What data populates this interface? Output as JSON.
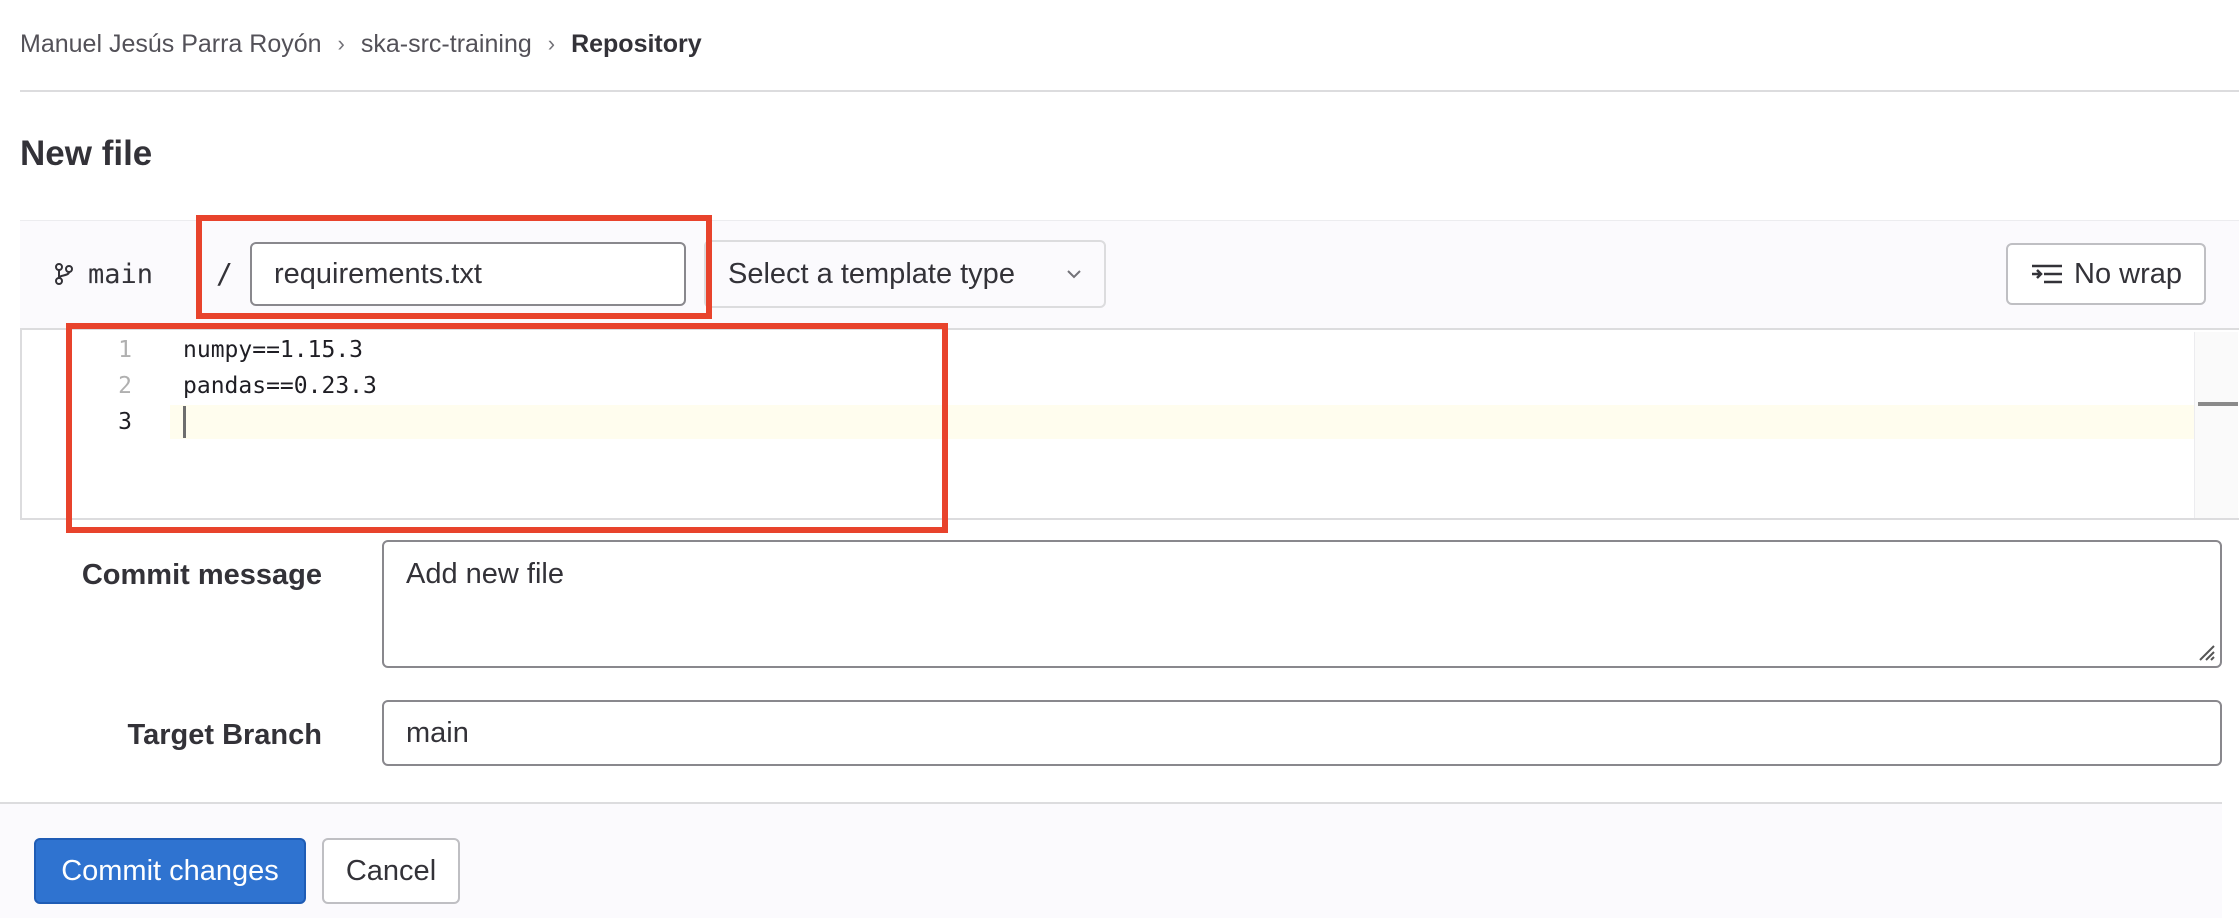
{
  "breadcrumb": {
    "items": [
      "Manuel Jesús Parra Royón",
      "ska-src-training",
      "Repository"
    ],
    "separator": "›"
  },
  "page": {
    "title": "New file"
  },
  "editor": {
    "branch_icon": "branch-icon",
    "branch": "main",
    "path_separator": "/",
    "filename": "requirements.txt",
    "template_placeholder": "Select a template type",
    "wrap_button": "No wrap",
    "line_numbers": [
      "1",
      "2",
      "3"
    ],
    "lines": [
      "numpy==1.15.3",
      "pandas==0.23.3",
      ""
    ]
  },
  "commit": {
    "message_label": "Commit message",
    "message_value": "Add new file",
    "branch_label": "Target Branch",
    "branch_value": "main"
  },
  "actions": {
    "commit": "Commit changes",
    "cancel": "Cancel"
  },
  "colors": {
    "primary": "#2f73d0",
    "highlight": "#e8432c",
    "active_line": "#fffdee"
  }
}
